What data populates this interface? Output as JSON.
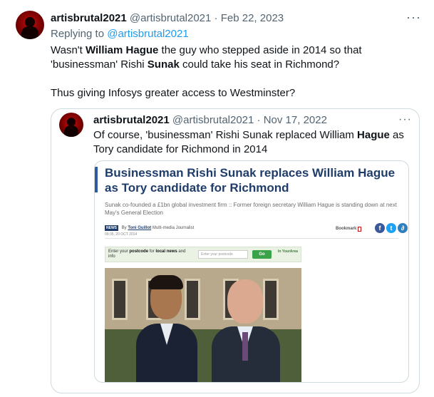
{
  "tweet": {
    "display_name": "artisbrutal2021",
    "handle": "@artisbrutal2021",
    "separator": "·",
    "date": "Feb 22, 2023",
    "more": "···",
    "replying_prefix": "Replying to",
    "replying_to": "@artisbrutal2021",
    "body": {
      "p1_a": "Wasn't ",
      "p1_b": "William Hague",
      "p1_c": " the guy who stepped aside in 2014 so that 'businessman' Rishi ",
      "p1_d": "Sunak",
      "p1_e": " could take his seat in Richmond?",
      "p2": "Thus giving Infosys greater access to Westminster?"
    }
  },
  "quoted": {
    "display_name": "artisbrutal2021",
    "handle": "@artisbrutal2021",
    "separator": "·",
    "date": "Nov 17, 2022",
    "more": "···",
    "text_a": "Of course, 'businessman' Rishi Sunak replaced William ",
    "text_b": "Hague",
    "text_c": " as Tory candidate for Richmond in 2014"
  },
  "article": {
    "headline": "Businessman Rishi Sunak replaces William Hague as Tory candidate for Richmond",
    "standfirst": "Sunak co-founded a £1bn global investment firm :: Former foreign secretary William Hague is standing down at next May's General Election",
    "news_tag": "NEWS",
    "by": "By",
    "author": "Toni Guillot",
    "author_role": "Multi-media Journalist",
    "timestamp": "09:35, 20 OCT 2014",
    "bookmark": "Bookmark",
    "social": {
      "facebook": "f",
      "twitter": "t",
      "other": "∂"
    },
    "postcode_prompt_a": "Enter your ",
    "postcode_prompt_b": "postcode",
    "postcode_prompt_c": " for ",
    "postcode_prompt_d": "local news",
    "postcode_prompt_e": " and info",
    "postcode_placeholder": "Enter your postcode",
    "go": "Go",
    "logo": "In YourArea"
  }
}
